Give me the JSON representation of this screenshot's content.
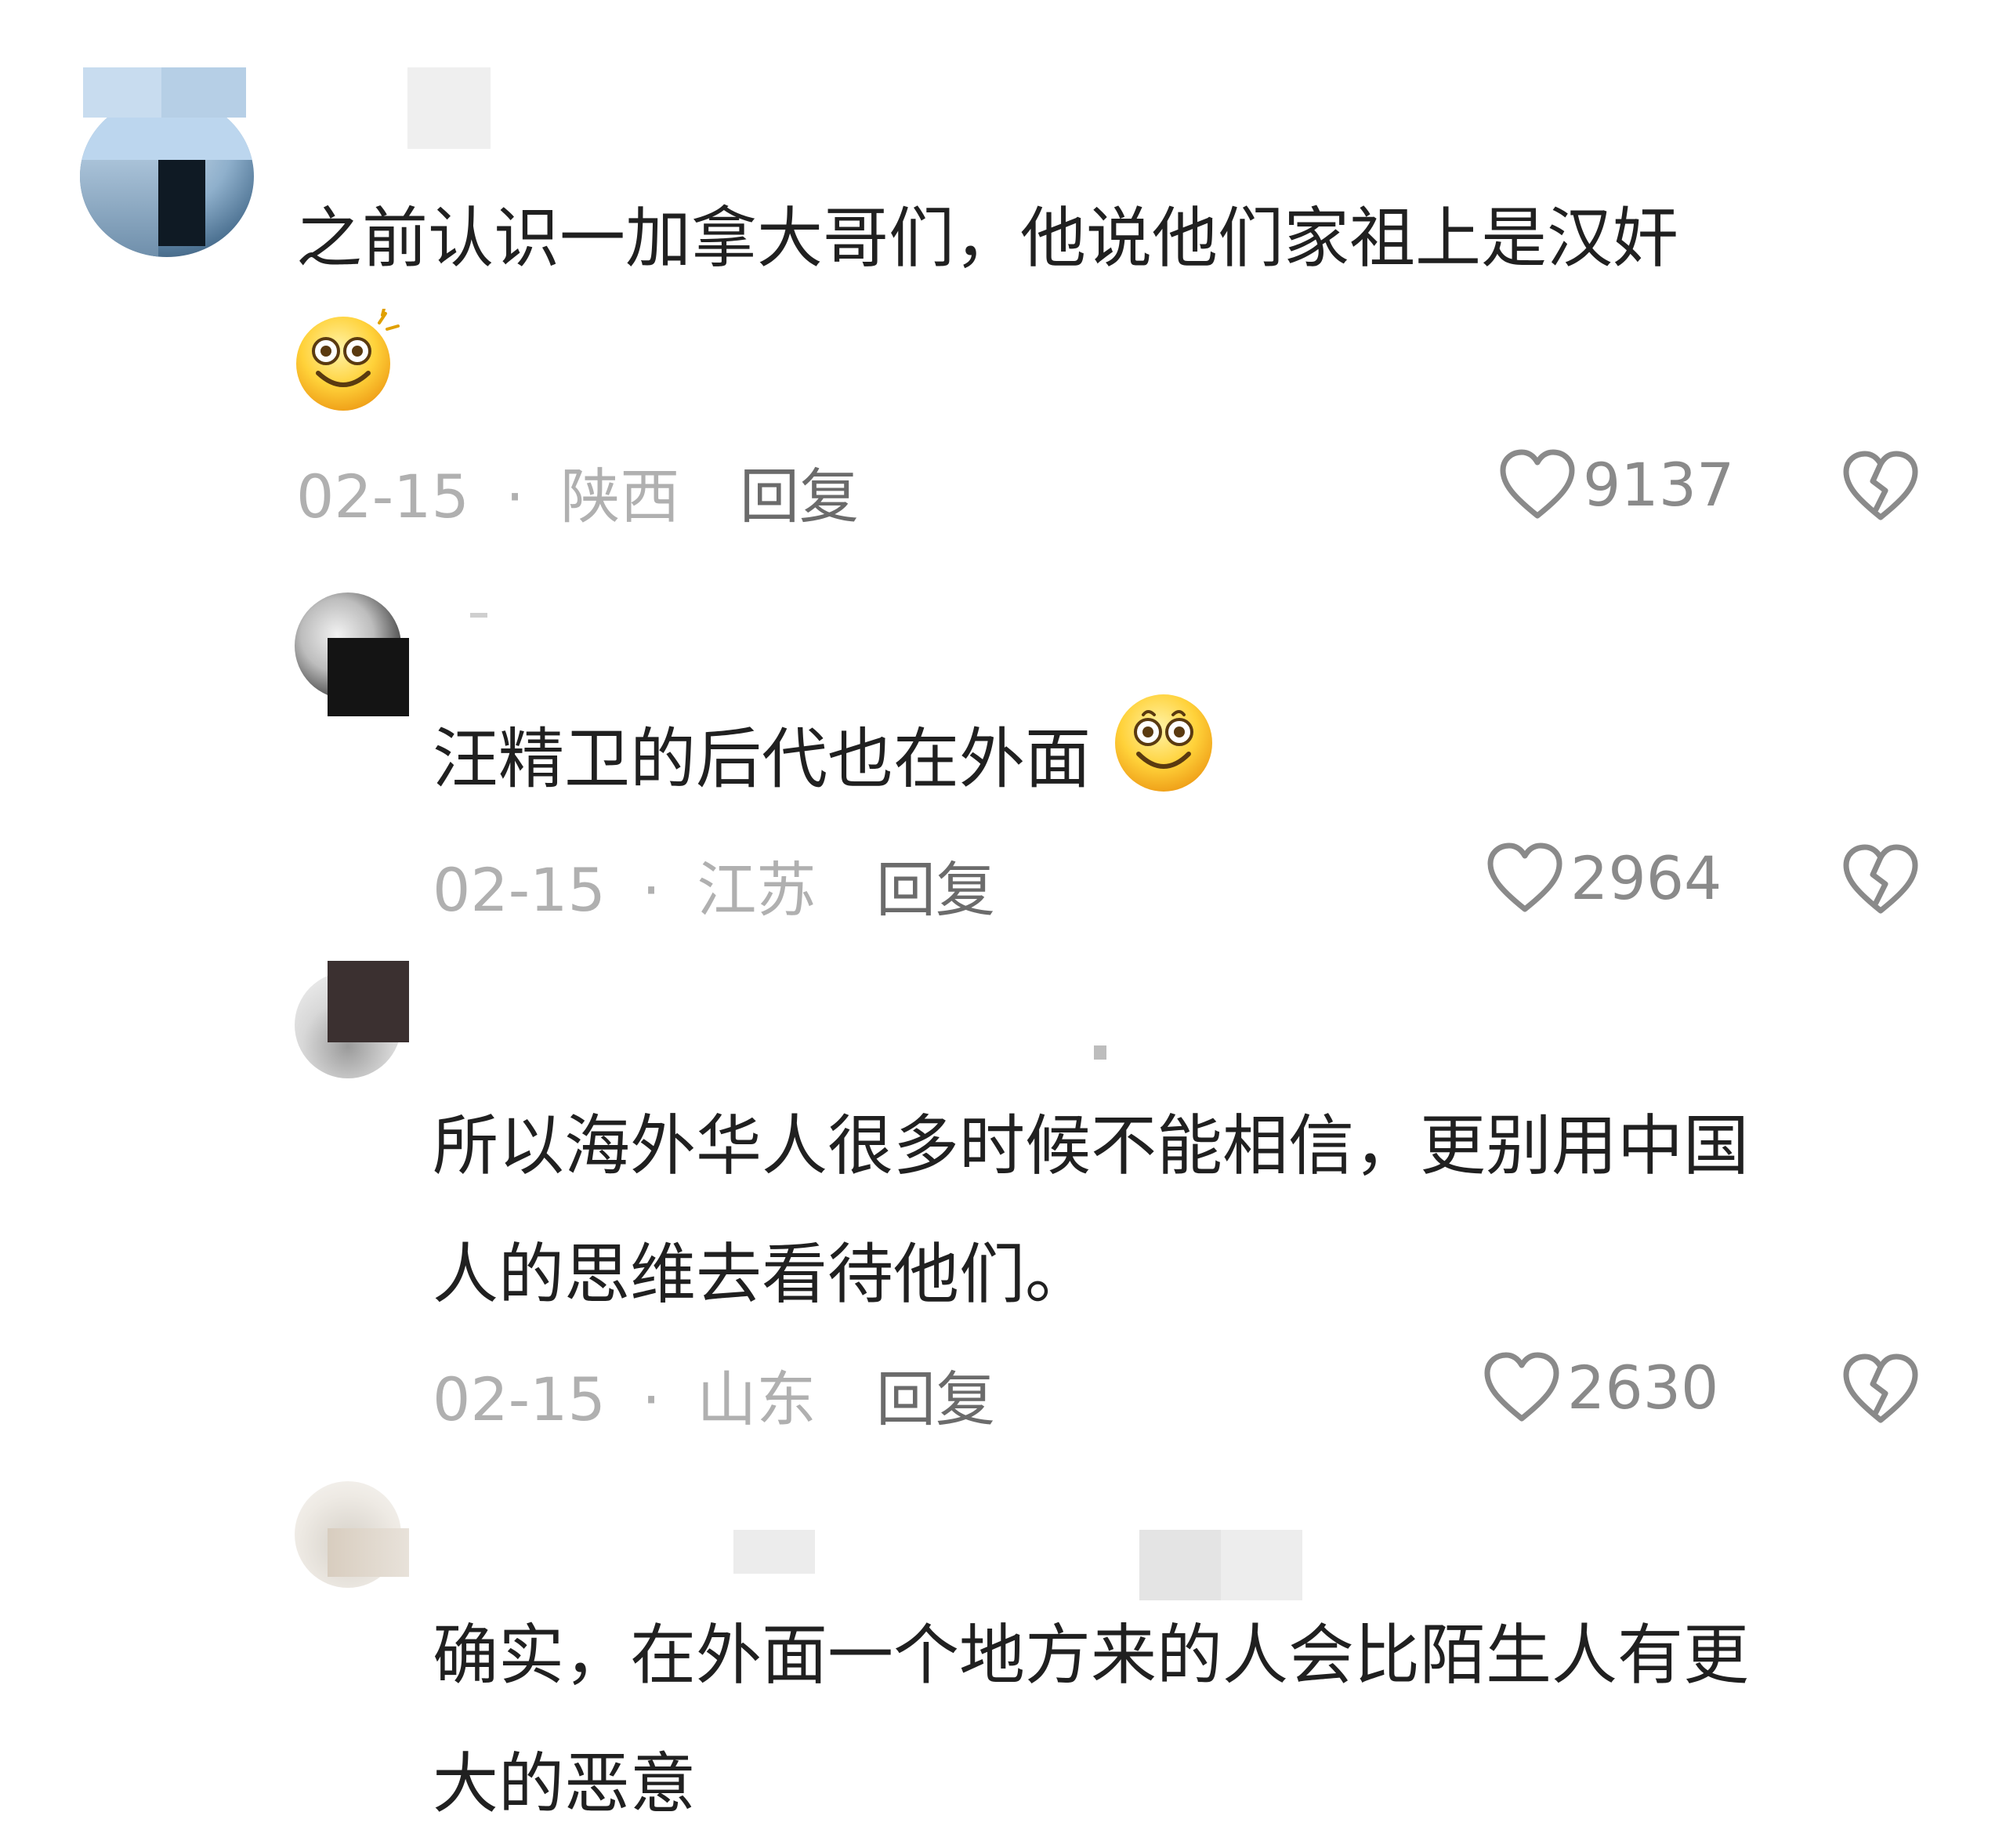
{
  "comments": [
    {
      "text_line1": "之前认识一加拿大哥们，他说他们家祖上是汉奸",
      "emoji": "dizzy-smile-emoji",
      "date": "02-15",
      "separator": "·",
      "location": "陕西",
      "reply_label": "回复",
      "likes": "9137"
    },
    {
      "text_line1": "汪精卫的后代也在外面",
      "emoji": "smile-emoji",
      "date": "02-15",
      "separator": "·",
      "location": "江苏",
      "reply_label": "回复",
      "likes": "2964"
    },
    {
      "text_line1": "所以海外华人很多时候不能相信，更别用中国",
      "text_line2": "人的思维去看待他们。",
      "date": "02-15",
      "separator": "·",
      "location": "山东",
      "reply_label": "回复",
      "likes": "2630"
    },
    {
      "text_line1": "确实，在外面一个地方来的人会比陌生人有更",
      "text_line2": "大的恶意"
    }
  ],
  "icons": {
    "like": "heart-outline-icon",
    "dislike": "broken-heart-icon"
  },
  "colors": {
    "text": "#202020",
    "meta": "#b0b0b0",
    "reply": "#6b6b6b",
    "icon": "#8a8a8a"
  }
}
